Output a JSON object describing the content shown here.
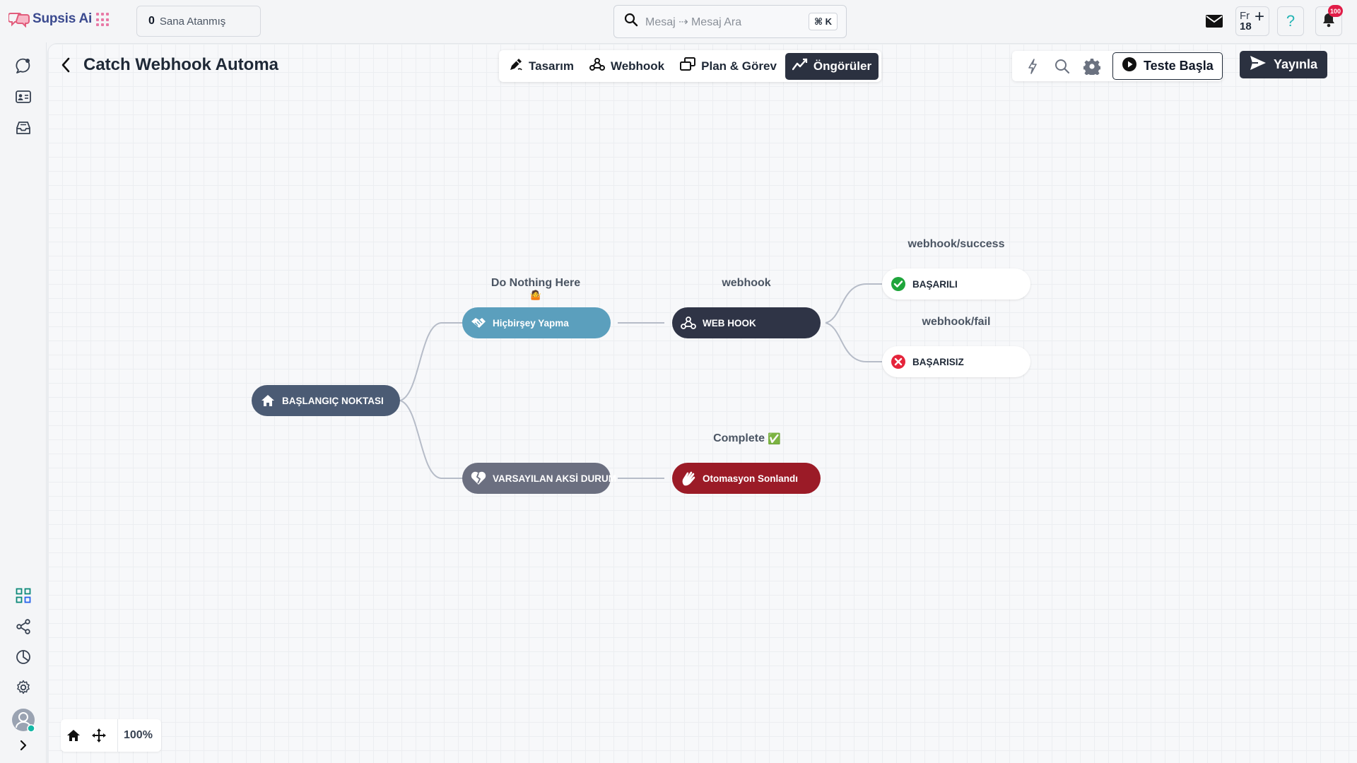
{
  "app": {
    "name": "Supsis Ai"
  },
  "header": {
    "assigned_count": "0",
    "assigned_label": "Sana Atanmış",
    "search_placeholder": "Mesaj ⇢ Mesaj Ara",
    "search_shortcut": "⌘ K",
    "lang_code": "Fr",
    "lang_number": "18",
    "notification_count": "100"
  },
  "page": {
    "title": "Catch Webhook Automa"
  },
  "tabs": [
    {
      "label": "Tasarım",
      "icon": "design-pen-icon",
      "active": false
    },
    {
      "label": "Webhook",
      "icon": "webhook-icon",
      "active": false
    },
    {
      "label": "Plan & Görev",
      "icon": "plan-task-icon",
      "active": false
    },
    {
      "label": "Öngörüler",
      "icon": "insights-chart-icon",
      "active": true
    }
  ],
  "actions": {
    "test_label": "Teste Başla",
    "publish_label": "Yayınla"
  },
  "flow": {
    "nodes": {
      "start": {
        "label": "BAŞLANGIÇ NOKTASI",
        "icon": "home-icon",
        "color": "#4b5b74"
      },
      "do_nothing": {
        "label": "Hiçbirşey Yapma",
        "icon": "handshake-icon",
        "color": "#5b9fbd"
      },
      "webhook": {
        "label": "WEB HOOK",
        "icon": "webhook-icon",
        "color": "#2f3446"
      },
      "success": {
        "label": "BAŞARILI",
        "icon": "check-circle-icon",
        "color": "#1fa53b"
      },
      "fail": {
        "label": "BAŞARISIZ",
        "icon": "x-circle-icon",
        "color": "#e5243b"
      },
      "default_fail": {
        "label": "VARSAYILAN AKSİ DURUM",
        "icon": "broken-heart-icon",
        "color": "#6b6f80"
      },
      "ended": {
        "label": "Otomasyon Sonlandı",
        "icon": "waving-hand-icon",
        "color": "#9b1b27"
      }
    },
    "labels": {
      "do_nothing_here": "Do Nothing Here",
      "do_nothing_emoji": "🤷",
      "webhook": "webhook",
      "success": "webhook/success",
      "fail": "webhook/fail",
      "complete": "Complete",
      "complete_emoji": "✅"
    }
  },
  "zoom": {
    "level": "100%"
  },
  "colors": {
    "accent_dark": "#2b3140",
    "brand": "#3b4a8f",
    "edge": "#b6bcc8"
  }
}
